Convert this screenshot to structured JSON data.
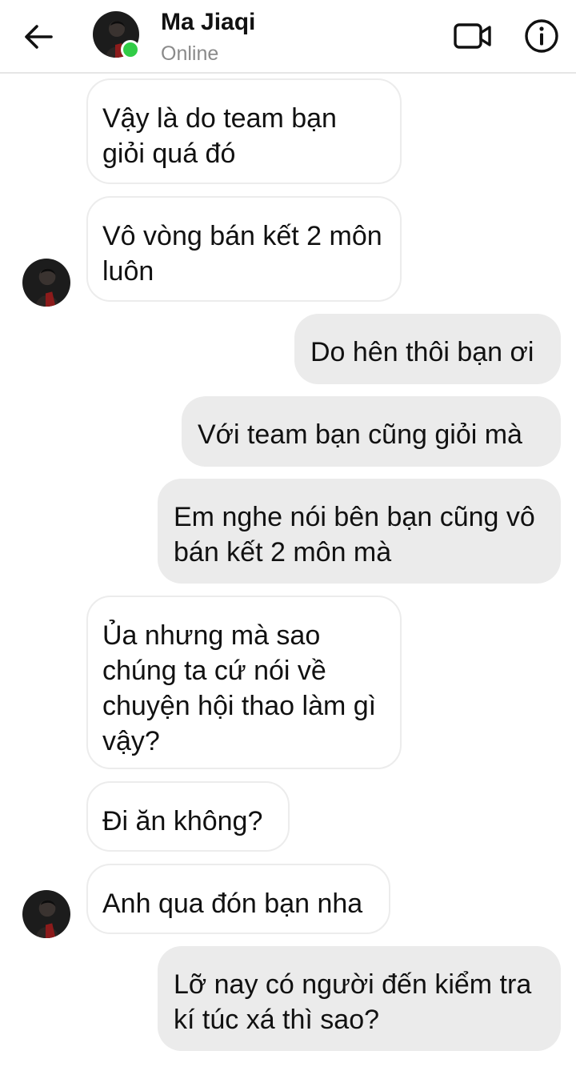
{
  "header": {
    "contact_name": "Ma Jiaqi",
    "status": "Online",
    "online_color": "#31cc46",
    "icons": [
      "back-arrow-icon",
      "video-call-icon",
      "info-icon"
    ]
  },
  "messages": [
    {
      "direction": "in",
      "text": "Vậy là do team bạn giỏi quá đó"
    },
    {
      "direction": "in",
      "text": "Vô vòng bán kết 2 môn luôn"
    },
    {
      "direction": "out",
      "text": "Do hên thôi bạn ơi"
    },
    {
      "direction": "out",
      "text": "Với team bạn cũng giỏi mà"
    },
    {
      "direction": "out",
      "text": "Em nghe nói bên bạn cũng vô bán kết 2 môn mà"
    },
    {
      "direction": "in",
      "text": "Ủa nhưng mà sao chúng ta cứ nói về chuyện hội thao làm gì vậy?"
    },
    {
      "direction": "in",
      "text": "Đi ăn không?"
    },
    {
      "direction": "in",
      "text": "Anh qua đón bạn nha"
    },
    {
      "direction": "out",
      "text": "Lỡ nay có người đến kiểm tra kí túc xá thì sao?"
    }
  ],
  "colors": {
    "incoming_bubble": "#ffffff",
    "outgoing_bubble": "#ebebeb",
    "status_text": "#8a8a8a"
  }
}
